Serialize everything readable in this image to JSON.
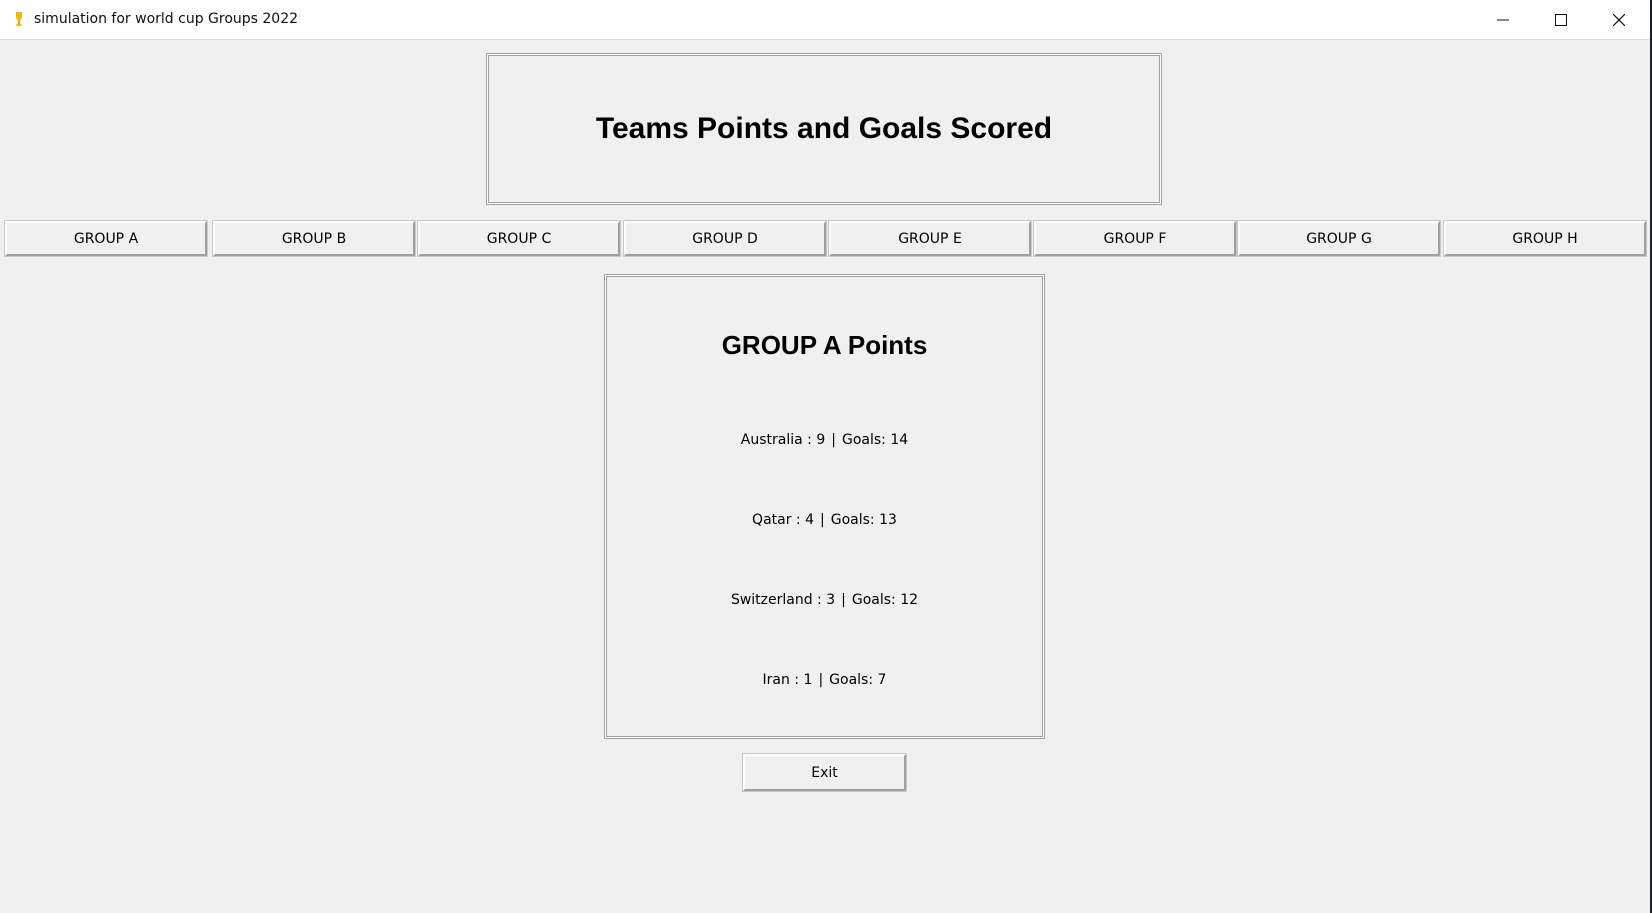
{
  "window": {
    "title": "simulation for world cup Groups 2022",
    "controls": [
      "minimize-icon",
      "maximize-icon",
      "close-icon"
    ]
  },
  "header": {
    "title": "Teams Points and Goals Scored"
  },
  "groups": [
    {
      "label": "GROUP A"
    },
    {
      "label": "GROUP B"
    },
    {
      "label": "GROUP C"
    },
    {
      "label": "GROUP D"
    },
    {
      "label": "GROUP E"
    },
    {
      "label": "GROUP F"
    },
    {
      "label": "GROUP G"
    },
    {
      "label": "GROUP H"
    }
  ],
  "points_panel": {
    "title": "GROUP A Points",
    "separator": "|",
    "goals_label": "Goals:",
    "teams": [
      {
        "name": "Australia",
        "points": "9",
        "goals": "14"
      },
      {
        "name": "Qatar",
        "points": "4",
        "goals": "13"
      },
      {
        "name": "Switzerland",
        "points": "3",
        "goals": "12"
      },
      {
        "name": "Iran",
        "points": "1",
        "goals": "7"
      }
    ]
  },
  "exit_label": "Exit",
  "colors": {
    "background": "#f0f0f0",
    "titlebar": "#ffffff",
    "icon_accent": "#f2b705"
  }
}
